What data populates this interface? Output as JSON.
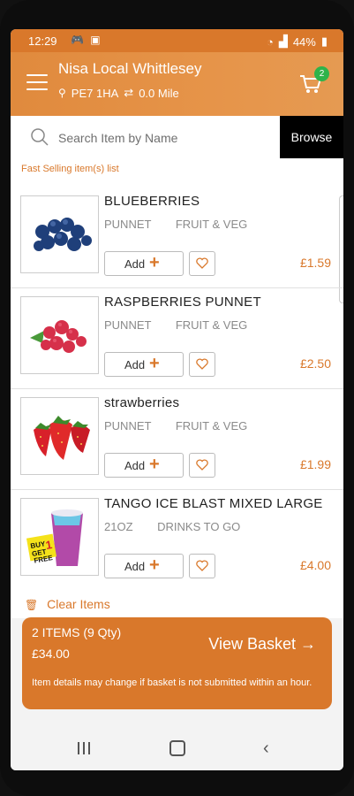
{
  "status_bar": {
    "time": "12:29",
    "battery": "44%"
  },
  "header": {
    "store_name": "Nisa Local Whittlesey",
    "postcode": "PE7 1HA",
    "distance": "0.0 Mile",
    "cart_count": "2"
  },
  "search": {
    "placeholder": "Search Item by Name",
    "browse_label": "Browse"
  },
  "list": {
    "title": "Fast Selling item(s) list",
    "items": [
      {
        "name": "BLUEBERRIES",
        "unit": "PUNNET",
        "category": "FRUIT & VEG",
        "add_label": "Add",
        "price": "£1.59",
        "image": "blueberries-image"
      },
      {
        "name": "RASPBERRIES PUNNET",
        "unit": "PUNNET",
        "category": "FRUIT & VEG",
        "add_label": "Add",
        "price": "£2.50",
        "image": "raspberries-image"
      },
      {
        "name": "strawberries",
        "unit": "PUNNET",
        "category": "FRUIT & VEG",
        "add_label": "Add",
        "price": "£1.99",
        "image": "strawberries-image"
      },
      {
        "name": "TANGO ICE BLAST MIXED LARGE",
        "unit": "21OZ",
        "category": "DRINKS TO GO",
        "add_label": "Add",
        "price": "£4.00",
        "image": "tango-ice-blast-image"
      }
    ]
  },
  "basket": {
    "clear_label": "Clear Items",
    "items_summary": "2 ITEMS  (9 Qty)",
    "total": "£34.00",
    "view_label": "View Basket",
    "notice": "Item details may change if basket is not submitted within an hour."
  },
  "promo_text": {
    "line1": "BUY",
    "line2": "GET",
    "line3": "1",
    "line4": "FREE"
  },
  "colors": {
    "accent": "#d9782b",
    "header": "#e08a3d",
    "badge": "#2fb34a",
    "browse_bg": "#000000"
  }
}
